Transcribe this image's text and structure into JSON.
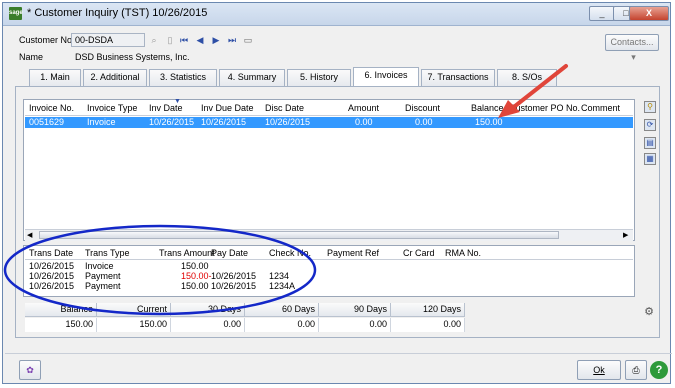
{
  "window": {
    "title": "* Customer Inquiry (TST) 10/26/2015",
    "app_icon_text": "sage",
    "minimize": "_",
    "maximize": "□",
    "close": "X"
  },
  "header": {
    "customer_no_label": "Customer No.",
    "customer_no_value": "00-DSDA",
    "name_label": "Name",
    "name_value": "DSD Business Systems, Inc.",
    "contacts_label": "Contacts..."
  },
  "tabs": [
    {
      "label": "1. Main"
    },
    {
      "label": "2. Additional"
    },
    {
      "label": "3. Statistics"
    },
    {
      "label": "4. Summary"
    },
    {
      "label": "5. History"
    },
    {
      "label": "6. Invoices",
      "active": true
    },
    {
      "label": "7. Transactions"
    },
    {
      "label": "8. S/Os"
    }
  ],
  "invoices": {
    "columns": [
      "Invoice No.",
      "Invoice Type",
      "Inv Date",
      "Inv Due Date",
      "Disc Date",
      "Amount",
      "Discount",
      "Balance",
      "Customer PO No.",
      "Comment"
    ],
    "rows": [
      {
        "invoice_no": "0051629",
        "invoice_type": "Invoice",
        "inv_date": "10/26/2015",
        "inv_due_date": "10/26/2015",
        "disc_date": "10/26/2015",
        "amount": "0.00",
        "discount": "0.00",
        "balance": "150.00",
        "customer_po": "",
        "comment": ""
      }
    ]
  },
  "transactions": {
    "columns": [
      "Trans Date",
      "Trans Type",
      "Trans Amount",
      "Pay Date",
      "Check No.",
      "Payment Ref",
      "Cr Card",
      "RMA No."
    ],
    "rows": [
      {
        "trans_date": "10/26/2015",
        "trans_type": "Invoice",
        "trans_amount": "150.00",
        "pay_date": "",
        "check_no": ""
      },
      {
        "trans_date": "10/26/2015",
        "trans_type": "Payment",
        "trans_amount": "150.00-",
        "pay_date": "10/26/2015",
        "check_no": "1234"
      },
      {
        "trans_date": "10/26/2015",
        "trans_type": "Payment",
        "trans_amount": "150.00",
        "pay_date": "10/26/2015",
        "check_no": "1234A"
      }
    ]
  },
  "aging": {
    "columns": [
      "Balance",
      "Current",
      "30 Days",
      "60 Days",
      "90 Days",
      "120 Days"
    ],
    "values": [
      "150.00",
      "150.00",
      "0.00",
      "0.00",
      "0.00",
      "0.00"
    ]
  },
  "footer": {
    "ok_label": "Ok"
  },
  "colors": {
    "selection": "#3399ff",
    "annotation_oval": "#1428c8",
    "annotation_arrow": "#e0453a",
    "negative_amount": "#e00000"
  }
}
